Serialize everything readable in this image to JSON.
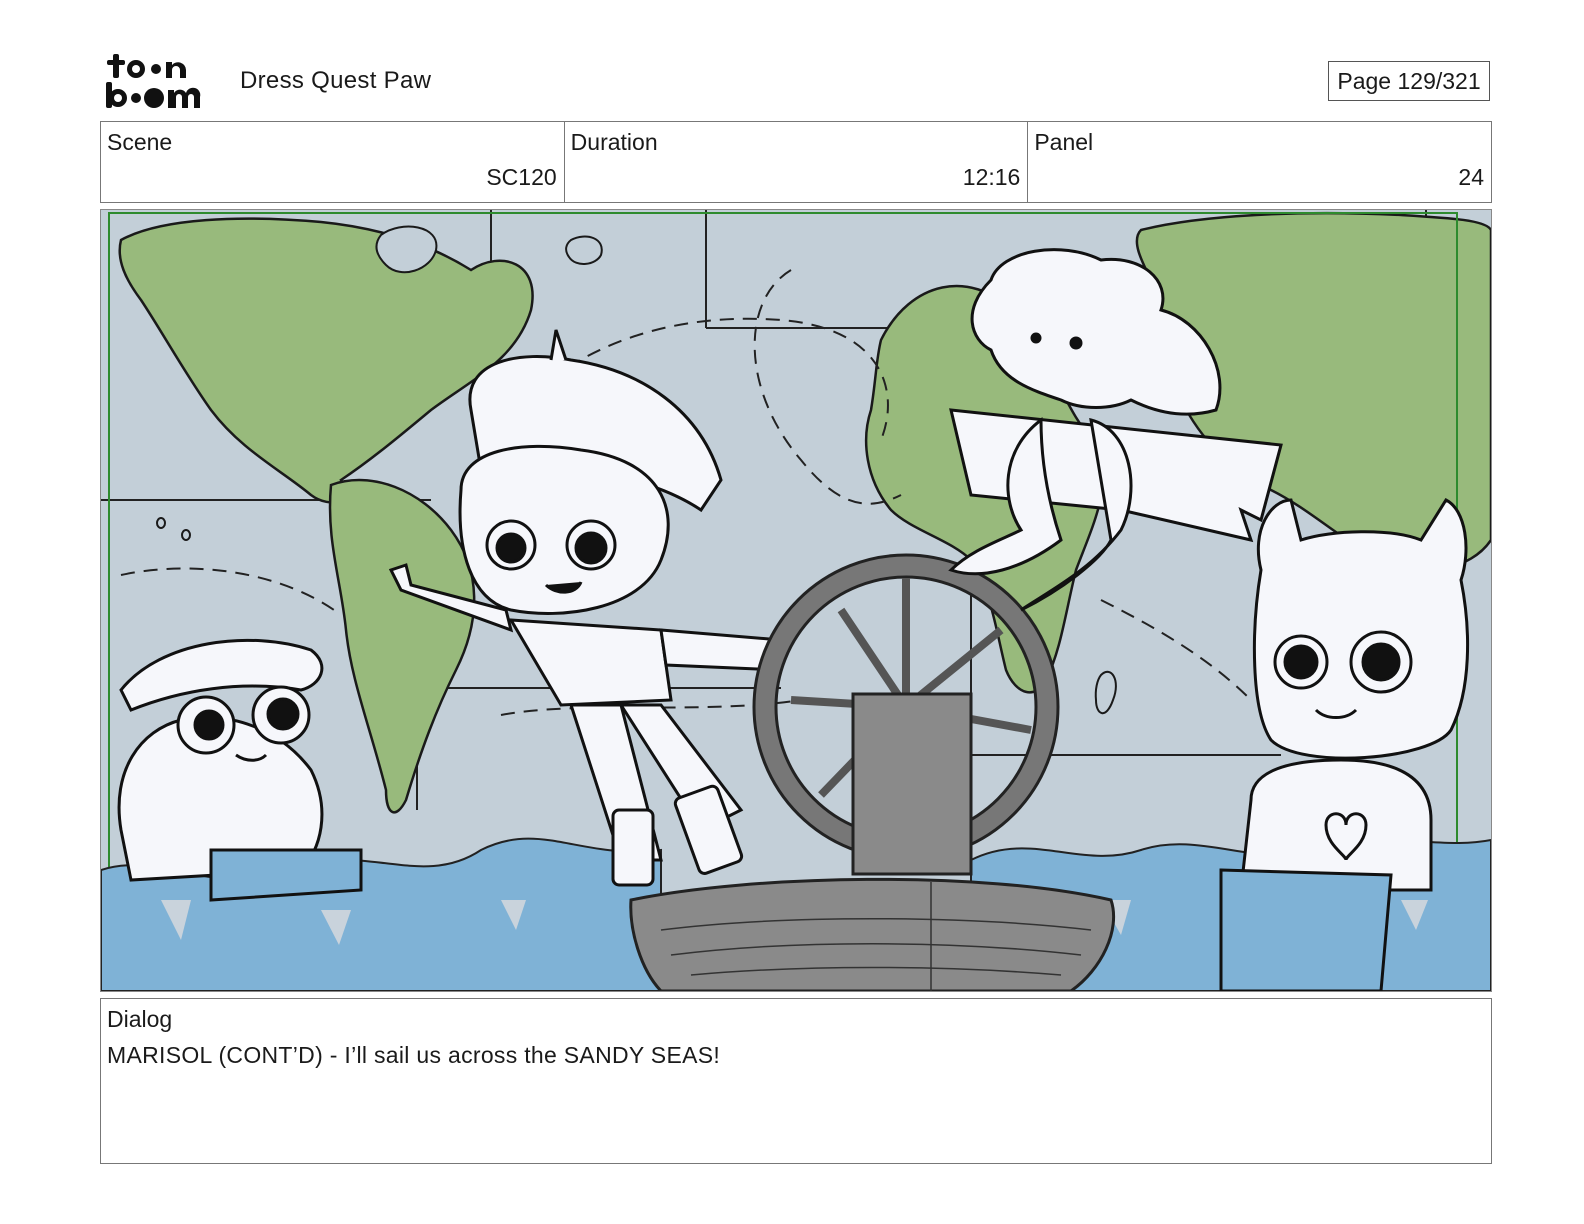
{
  "header": {
    "logo_text": "toon boom",
    "project_title": "Dress Quest Paw",
    "page_indicator": "Page 129/321"
  },
  "info": {
    "scene_label": "Scene",
    "scene_value": "SC120",
    "duration_label": "Duration",
    "duration_value": "12:16",
    "panel_label": "Panel",
    "panel_value": "24"
  },
  "panel_image": {
    "description_icon": "storyboard-drawing",
    "colors": {
      "ocean": "#c3cfd8",
      "land": "#98ba7c",
      "water": "#7fb2d6",
      "boat": "#8a8a8a",
      "safe_frame": "#2e8b2e"
    }
  },
  "dialog": {
    "label": "Dialog",
    "text": "MARISOL (CONT’D) - I’ll sail us across the SANDY SEAS!"
  }
}
